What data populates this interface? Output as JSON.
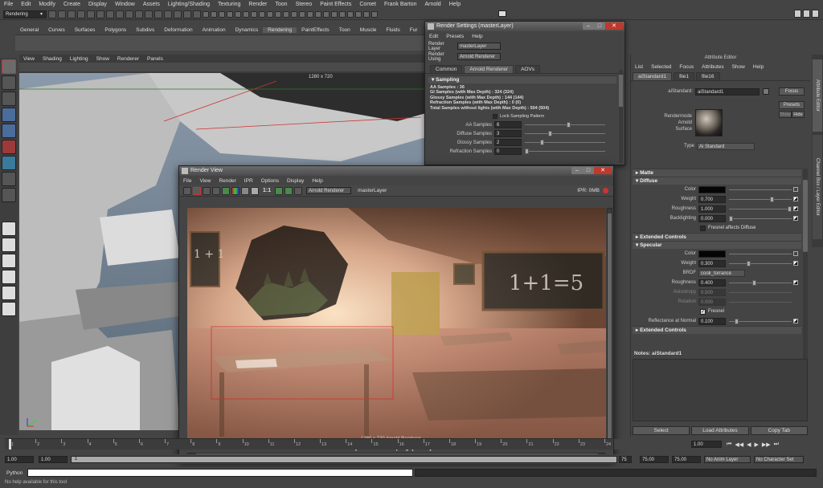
{
  "main_menu": [
    "File",
    "Edit",
    "Modify",
    "Create",
    "Display",
    "Window",
    "Assets",
    "Lighting/Shading",
    "Texturing",
    "Render",
    "Toon",
    "Stereo",
    "Paint Effects",
    "Comet",
    "Frank Barton",
    "Arnold",
    "Help"
  ],
  "mode_select": "Rendering",
  "shelf_tabs": [
    "General",
    "Curves",
    "Surfaces",
    "Polygons",
    "Subdivs",
    "Deformation",
    "Animation",
    "Dynamics",
    "Rendering",
    "PaintEffects",
    "Toon",
    "Muscle",
    "Fluids",
    "Fur",
    "Hair"
  ],
  "viewport": {
    "menu": [
      "View",
      "Shading",
      "Lighting",
      "Show",
      "Renderer",
      "Panels"
    ],
    "resolution": "1280 x 720"
  },
  "attribute_editor": {
    "title": "Attribute Editor",
    "menu": [
      "List",
      "Selected",
      "Focus",
      "Attributes",
      "Show",
      "Help"
    ],
    "tabs": [
      "aiStandard1",
      "file1",
      "file16"
    ],
    "node_label": "aiStandard:",
    "node_name": "aiStandard1",
    "focus": "Focus",
    "presets": "Presets",
    "show": "Show",
    "hide": "Hide",
    "swatch_caption": [
      "Rendermode",
      "Arnold",
      "Surface"
    ],
    "type_label": "Type",
    "type_value": "Ai Standard",
    "sections": {
      "matte": "Matte",
      "diffuse": "Diffuse",
      "extended": "Extended Controls",
      "specular": "Specular",
      "extended2": "Extended Controls"
    },
    "diffuse": {
      "color": "Color",
      "weight": "Weight",
      "weight_val": "0.700",
      "weight_pos": 0.7,
      "roughness": "Roughness",
      "roughness_val": "1.000",
      "roughness_pos": 1.0,
      "backlighting": "Backlighting",
      "backlighting_val": "0.000",
      "backlighting_pos": 0.0,
      "fresnel_affects": "Fresnel affects Diffuse"
    },
    "specular": {
      "color": "Color",
      "weight": "Weight",
      "weight_val": "0.300",
      "weight_pos": 0.3,
      "brdf": "BRDF",
      "brdf_val": "cook_torrance",
      "roughness": "Roughness",
      "roughness_val": "0.400",
      "roughness_pos": 0.4,
      "anisotropy": "Anisotropy",
      "anisotropy_val": "0.500",
      "rotation": "Rotation",
      "rotation_val": "0.000",
      "fresnel": "Fresnel",
      "reflectance": "Reflectance at Normal",
      "reflectance_val": "0.100",
      "reflectance_pos": 0.1
    },
    "notes": "Notes: aiStandard1",
    "buttons": [
      "Select",
      "Load Attributes",
      "Copy Tab"
    ]
  },
  "side_tabs": [
    "Attribute Editor",
    "Channel Box / Layer Editor"
  ],
  "render_settings": {
    "title": "Render Settings (masterLayer)",
    "menu": [
      "Edit",
      "Presets",
      "Help"
    ],
    "layer_label": "Render Layer",
    "layer_value": "masterLayer",
    "using_label": "Render Using",
    "using_value": "Arnold Renderer",
    "tabs": [
      "Common",
      "Arnold Renderer",
      "AOVs"
    ],
    "section": "Sampling",
    "stats": [
      "AA Samples : 36",
      "GI Samples (with Max Depth) : 324 (324)",
      "Glossy Samples (with Max Depth) : 144 (144)",
      "Refraction Samples (with Max Depth) : 0 (0)",
      "Total Samples without lights (with Max Depth) : 504 (504)"
    ],
    "lock_sampling": "Lock Sampling Pattern",
    "rows": [
      {
        "label": "AA Samples",
        "value": "6",
        "pos": 0.55
      },
      {
        "label": "Diffuse Samples",
        "value": "3",
        "pos": 0.3
      },
      {
        "label": "Glossy Samples",
        "value": "2",
        "pos": 0.2
      },
      {
        "label": "Refraction Samples",
        "value": "0",
        "pos": 0.0
      }
    ]
  },
  "render_view": {
    "title": "Render View",
    "menu": [
      "File",
      "View",
      "Render",
      "IPR",
      "Options",
      "Display",
      "Help"
    ],
    "ratio": "1:1",
    "renderer": "Arnold Renderer",
    "layer": "masterLayer",
    "ipr": "IPR: 0MB",
    "chalk_left": "1 + 1",
    "chalk_right": "1+1=5",
    "status_caption": "1280 x 720 Arnold Renderer",
    "frame": "Frame: 1",
    "memory": "Memory: 1558Mb",
    "sampling": "Sampling: [6/3/2/4]",
    "render_time": "Render Time: 5:31"
  },
  "timeline": {
    "ticks": [
      "1",
      "2",
      "3",
      "4",
      "5",
      "6",
      "7",
      "8",
      "9",
      "10",
      "11",
      "12",
      "13",
      "14",
      "15",
      "16",
      "17",
      "18",
      "19",
      "20",
      "21",
      "22",
      "23",
      "24"
    ],
    "current_frame": "1.00"
  },
  "range": {
    "start": "1.00",
    "start2": "1.00",
    "marker": "1",
    "end_a": "75",
    "end_b": "75.00",
    "end_c": "75.00",
    "anim_layer": "No Anim Layer",
    "char_set": "No Character Set"
  },
  "cmd": {
    "lang": "Python",
    "help": "No help available for this tool"
  },
  "colors": {
    "accent": "#5d88b8",
    "panel": "#444444",
    "dark": "#2b2b2b"
  }
}
